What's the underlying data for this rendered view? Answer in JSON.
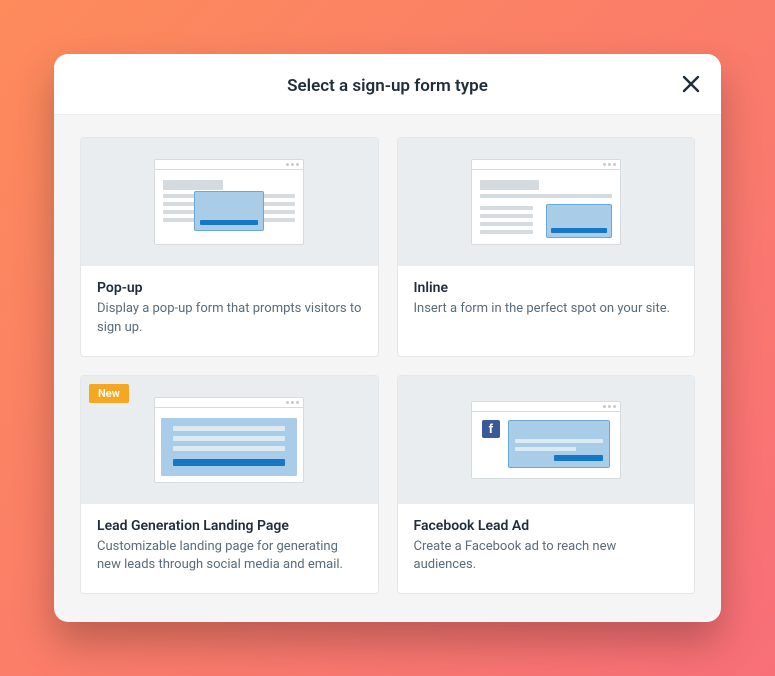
{
  "dialog": {
    "title": "Select a sign-up form type"
  },
  "cards": [
    {
      "title": "Pop-up",
      "desc": "Display a pop-up form that prompts visitors to sign up.",
      "badge": null
    },
    {
      "title": "Inline",
      "desc": "Insert a form in the perfect spot on your site.",
      "badge": null
    },
    {
      "title": "Lead Generation Landing Page",
      "desc": "Customizable landing page for generating new leads through social media and email.",
      "badge": "New"
    },
    {
      "title": "Facebook Lead Ad",
      "desc": "Create a Facebook ad to reach new audiences.",
      "badge": null
    }
  ]
}
